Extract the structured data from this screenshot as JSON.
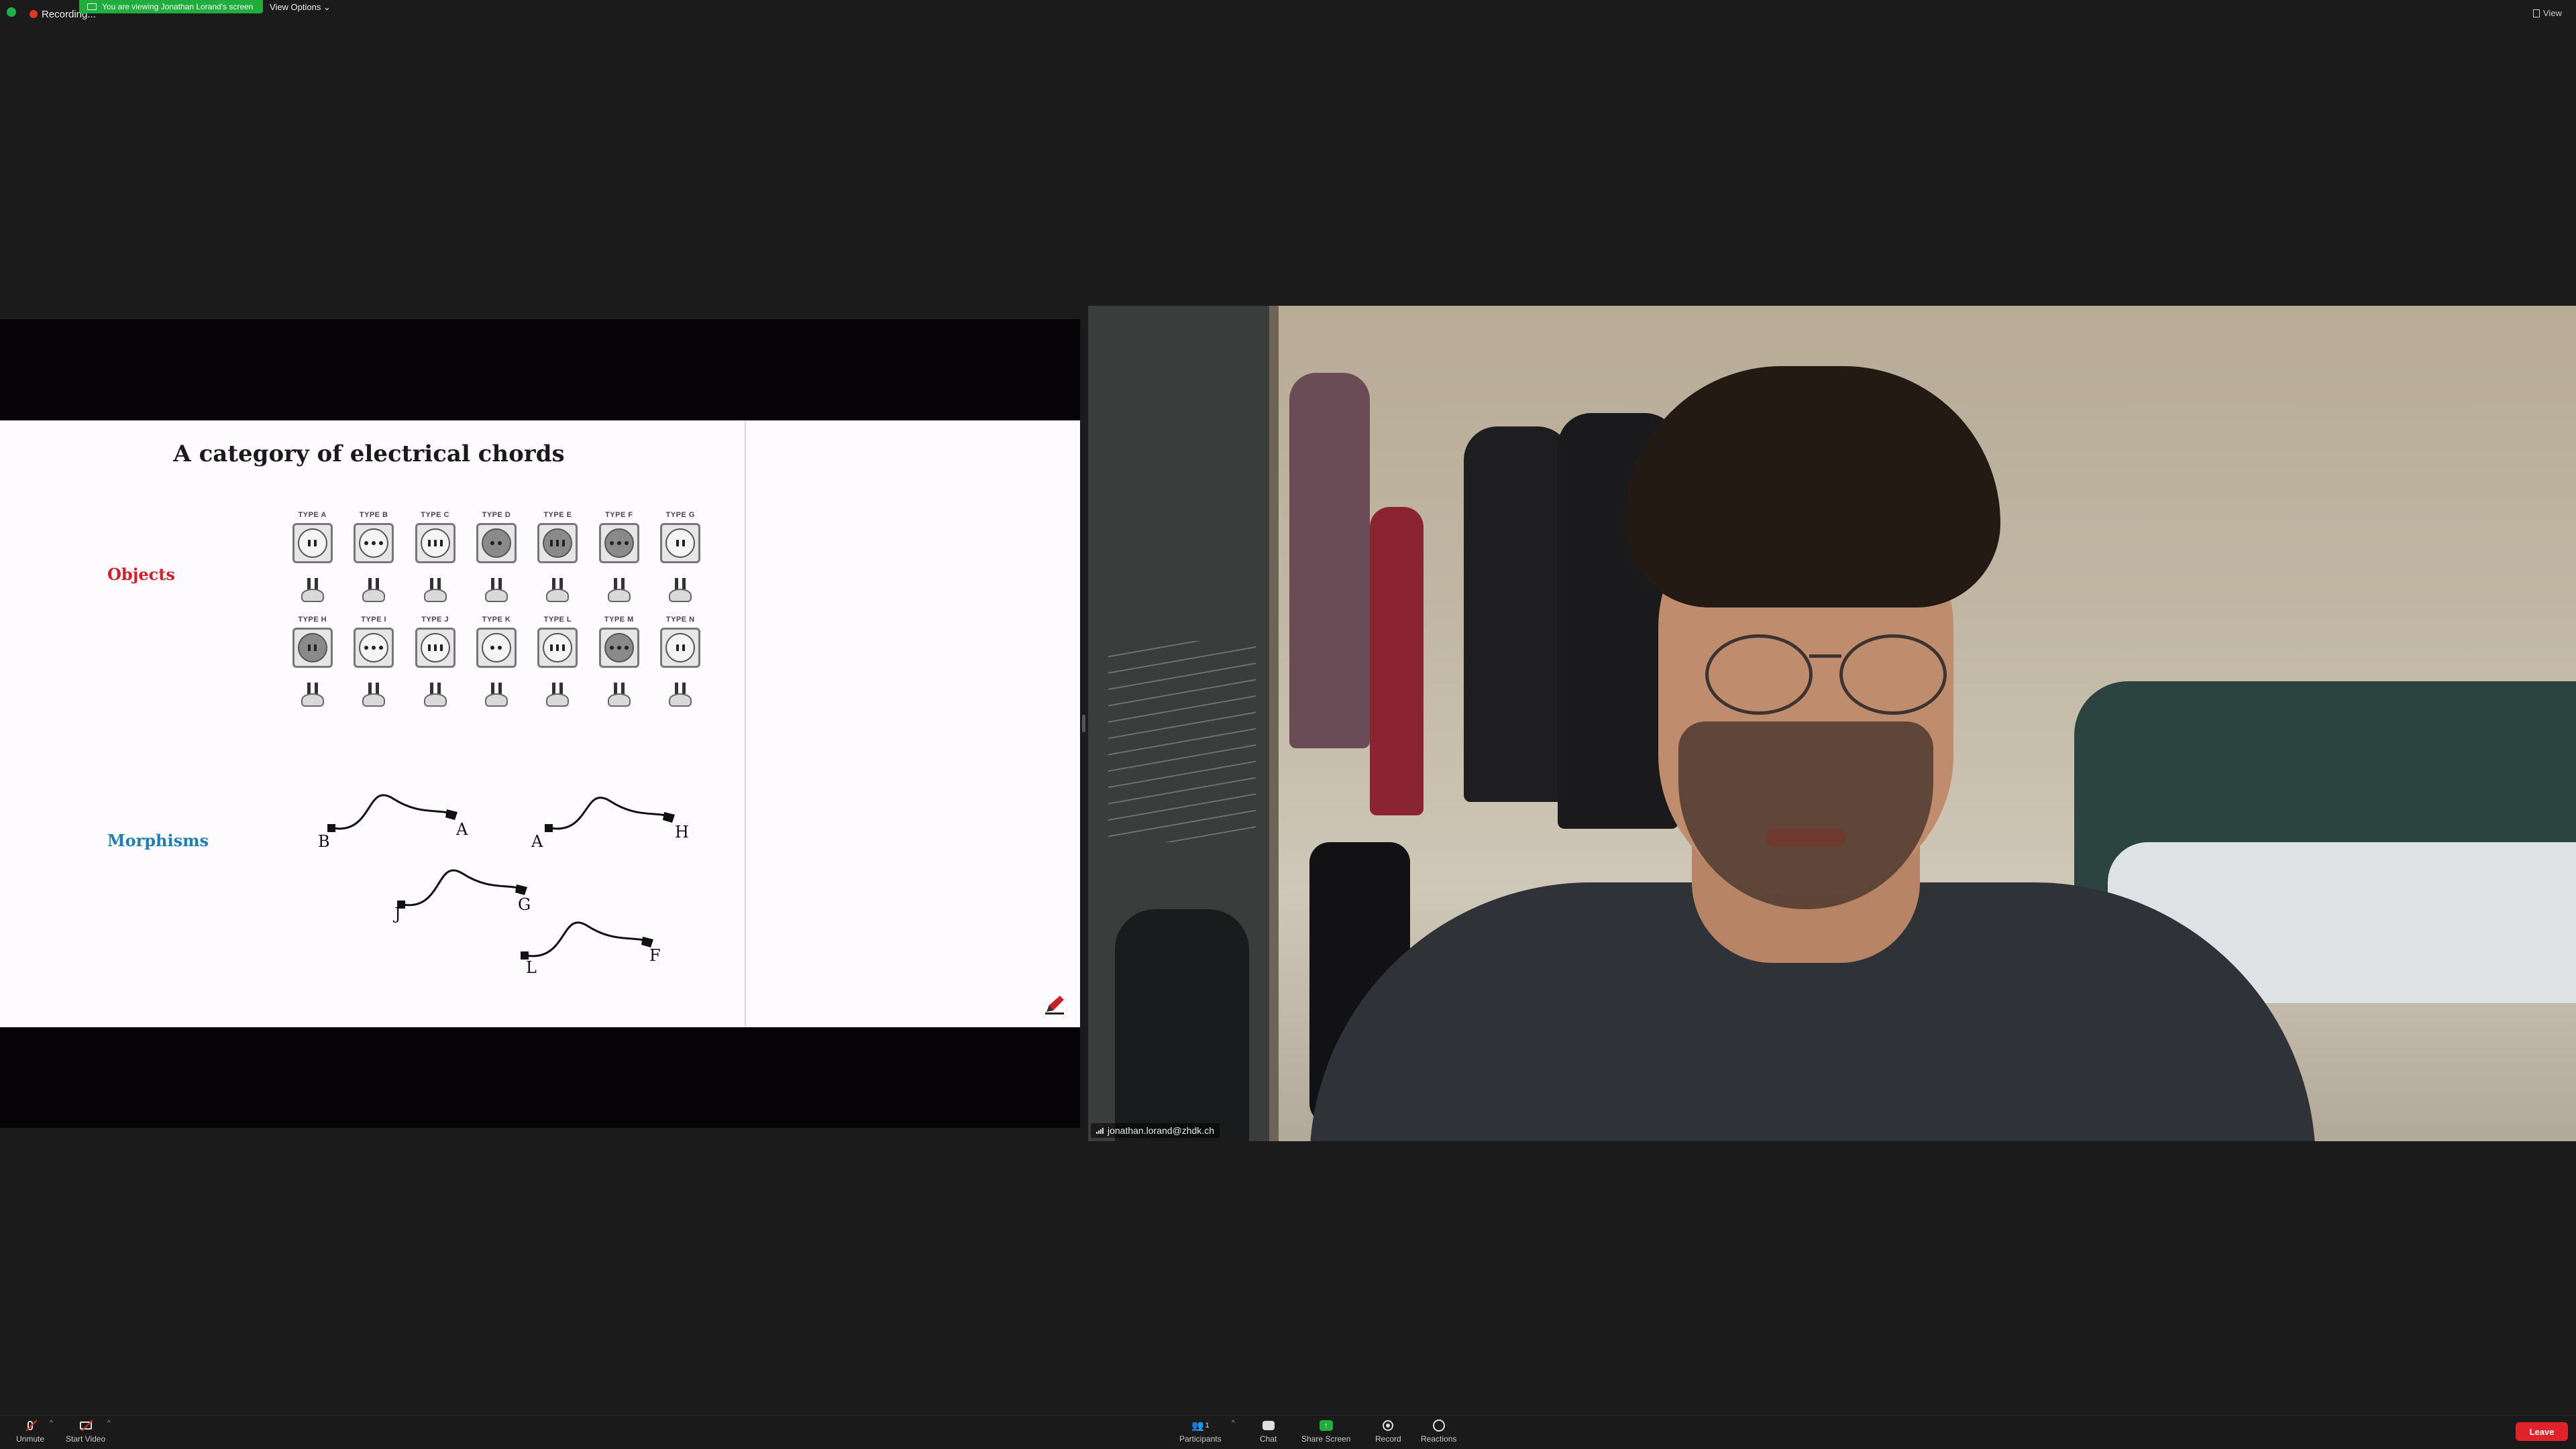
{
  "topbar": {
    "recording_label": "Recording...",
    "banner_text": "You are viewing Jonathan Lorand's screen",
    "view_options_label": "View Options ⌄",
    "view_label": "View"
  },
  "slide": {
    "title": "A category of electrical chords",
    "objects_label": "Objects",
    "morphisms_label": "Morphisms",
    "socket_rows": [
      [
        "TYPE A",
        "TYPE B",
        "TYPE C",
        "TYPE D",
        "TYPE E",
        "TYPE F",
        "TYPE G"
      ],
      [
        "TYPE H",
        "TYPE I",
        "TYPE J",
        "TYPE K",
        "TYPE L",
        "TYPE M",
        "TYPE N"
      ]
    ],
    "morphisms": [
      {
        "from": "B",
        "to": "A"
      },
      {
        "from": "A",
        "to": "H"
      },
      {
        "from": "J",
        "to": "G"
      },
      {
        "from": "L",
        "to": "F"
      }
    ]
  },
  "video": {
    "participant_name": "jonathan.lorand@zhdk.ch"
  },
  "toolbar": {
    "unmute_label": "Unmute",
    "start_video_label": "Start Video",
    "participants_label": "Participants",
    "participants_count": "1",
    "chat_label": "Chat",
    "share_screen_label": "Share Screen",
    "record_label": "Record",
    "reactions_label": "Reactions",
    "leave_label": "Leave"
  },
  "colors": {
    "green_accent": "#1fae3b",
    "leave_red": "#e0232b",
    "objects_red": "#d41e2b",
    "morphisms_blue": "#1c7fb5"
  }
}
